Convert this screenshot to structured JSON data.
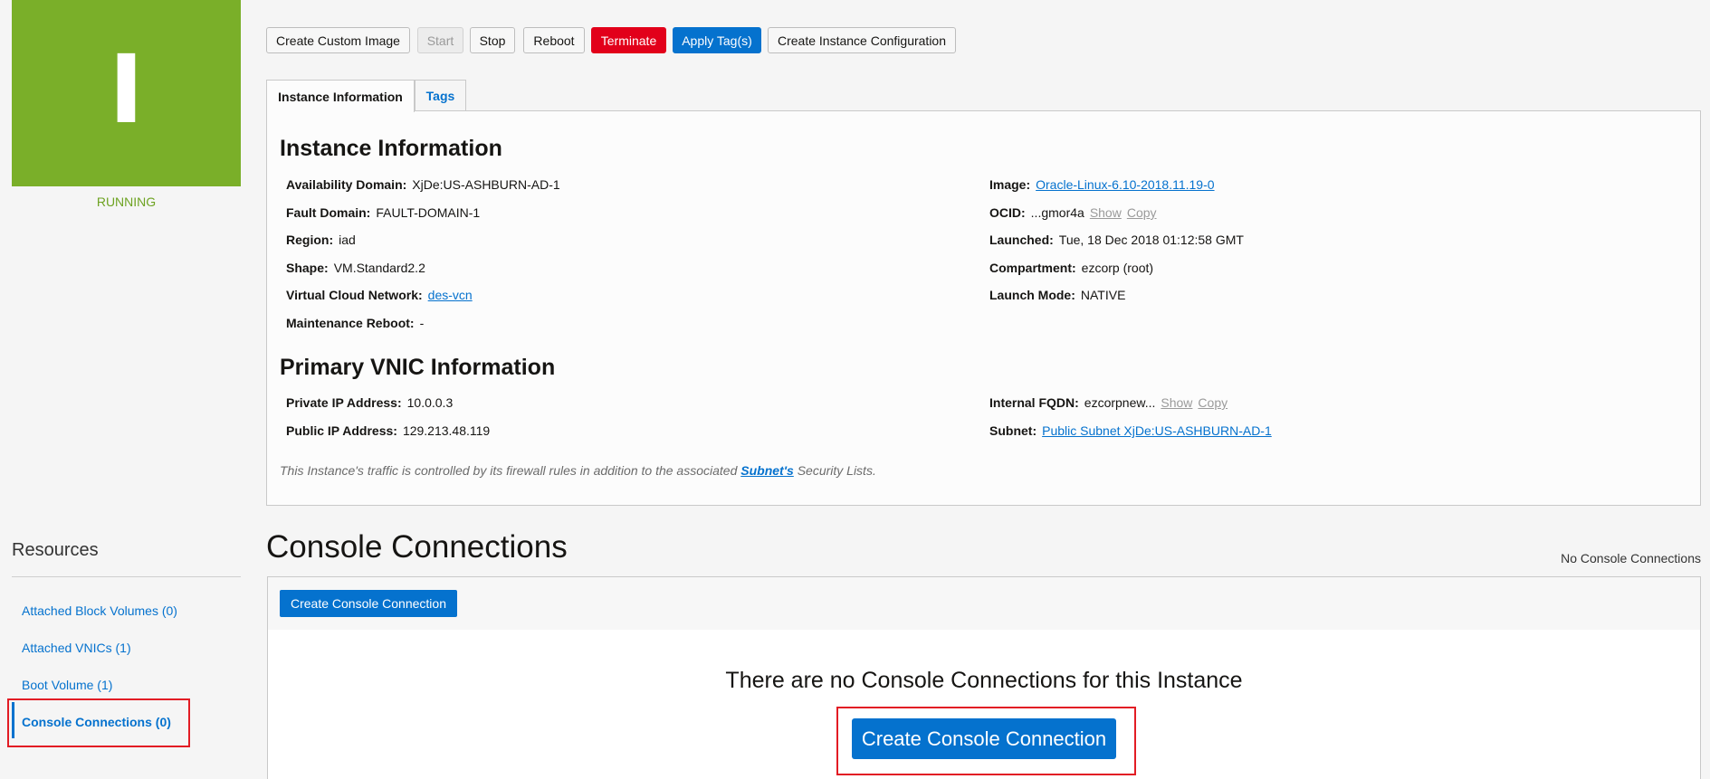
{
  "instance": {
    "icon_letter": "I",
    "status": "RUNNING"
  },
  "actions": {
    "create_custom_image": "Create Custom Image",
    "start": "Start",
    "stop": "Stop",
    "reboot": "Reboot",
    "terminate": "Terminate",
    "apply_tags": "Apply Tag(s)",
    "create_instance_configuration": "Create Instance Configuration"
  },
  "tabs": {
    "instance_information": "Instance Information",
    "tags": "Tags"
  },
  "instance_info": {
    "heading": "Instance Information",
    "availability_domain": {
      "label": "Availability Domain:",
      "value": "XjDe:US-ASHBURN-AD-1"
    },
    "fault_domain": {
      "label": "Fault Domain:",
      "value": "FAULT-DOMAIN-1"
    },
    "region": {
      "label": "Region:",
      "value": "iad"
    },
    "shape": {
      "label": "Shape:",
      "value": "VM.Standard2.2"
    },
    "vcn": {
      "label": "Virtual Cloud Network:",
      "value": "des-vcn"
    },
    "maintenance_reboot": {
      "label": "Maintenance Reboot:",
      "value": "-"
    },
    "image": {
      "label": "Image:",
      "value": "Oracle-Linux-6.10-2018.11.19-0"
    },
    "ocid": {
      "label": "OCID:",
      "value": "...gmor4a",
      "show": "Show",
      "copy": "Copy"
    },
    "launched": {
      "label": "Launched:",
      "value": "Tue, 18 Dec 2018 01:12:58 GMT"
    },
    "compartment": {
      "label": "Compartment:",
      "value": "ezcorp (root)"
    },
    "launch_mode": {
      "label": "Launch Mode:",
      "value": "NATIVE"
    }
  },
  "vnic_info": {
    "heading": "Primary VNIC Information",
    "private_ip": {
      "label": "Private IP Address:",
      "value": "10.0.0.3"
    },
    "public_ip": {
      "label": "Public IP Address:",
      "value": "129.213.48.119"
    },
    "internal_fqdn": {
      "label": "Internal FQDN:",
      "value": "ezcorpnew...",
      "show": "Show",
      "copy": "Copy"
    },
    "subnet": {
      "label": "Subnet:",
      "value": "Public Subnet XjDe:US-ASHBURN-AD-1"
    },
    "note_before": "This Instance's traffic is controlled by its firewall rules in addition to the associated ",
    "note_link": "Subnet's",
    "note_after": " Security Lists."
  },
  "resources": {
    "title": "Resources",
    "items": [
      {
        "label": "Attached Block Volumes (0)"
      },
      {
        "label": "Attached VNICs (1)"
      },
      {
        "label": "Boot Volume (1)"
      },
      {
        "label": "Console Connections (0)"
      }
    ]
  },
  "console_connections": {
    "title": "Console Connections",
    "count_text": "No Console Connections",
    "create_button": "Create Console Connection",
    "empty_message": "There are no Console Connections for this Instance",
    "create_button_large": "Create Console Connection"
  },
  "colors": {
    "accent": "#0572ce",
    "running": "#7aaf29",
    "danger": "#e2001a",
    "highlight": "#e21c24"
  }
}
